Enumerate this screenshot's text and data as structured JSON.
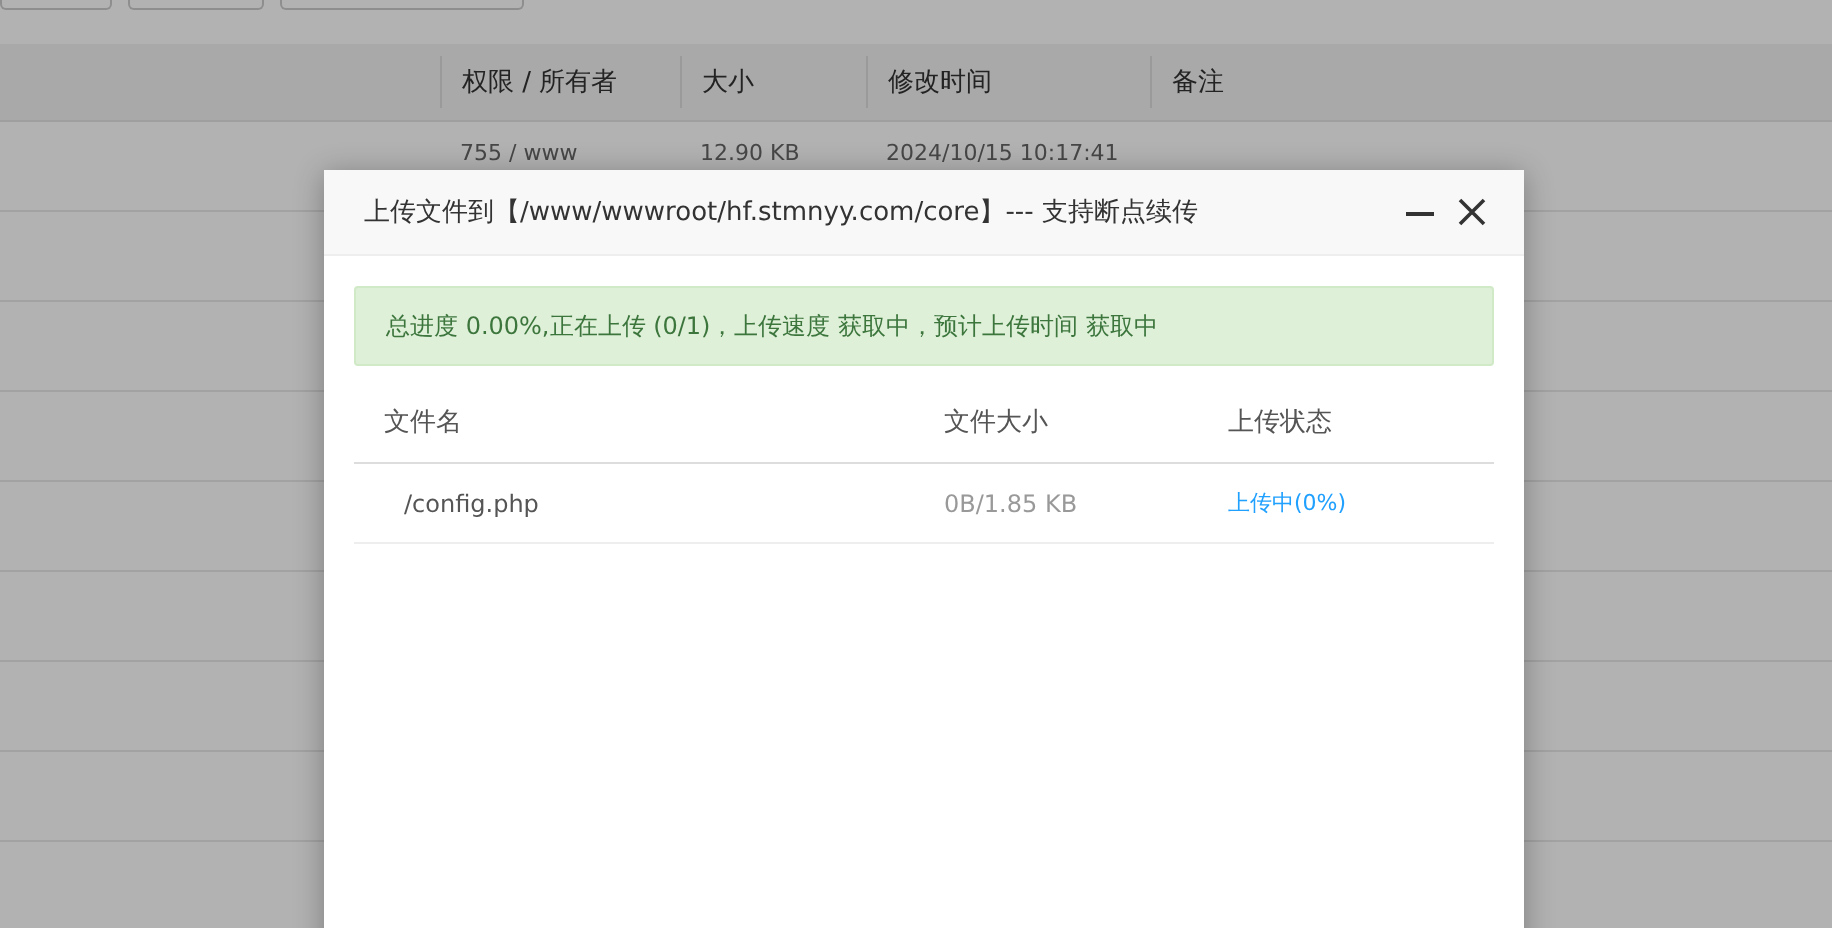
{
  "file_table": {
    "columns": [
      "权限 / 所有者",
      "大小",
      "修改时间",
      "备注"
    ],
    "rows": [
      {
        "permission": "755 / www",
        "size": "12.90 KB",
        "modified": "2024/10/15 10:17:41"
      }
    ]
  },
  "dialog": {
    "title": "上传文件到【/www/wwwroot/hf.stmnyy.com/core】--- 支持断点续传",
    "progress_message": "总进度 0.00%,正在上传 (0/1)，上传速度 获取中，预计上传时间 获取中",
    "columns": [
      "文件名",
      "文件大小",
      "上传状态"
    ],
    "files": [
      {
        "name": "/config.php",
        "size": "0B/1.85 KB",
        "status": "上传中(0%)"
      }
    ]
  }
}
